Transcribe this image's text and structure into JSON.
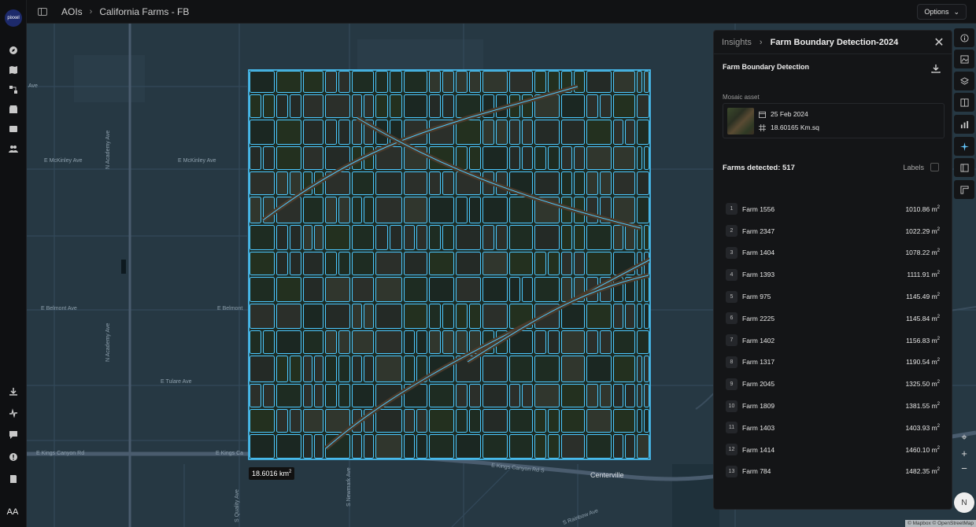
{
  "logo": {
    "text": "pixxel"
  },
  "avatar": {
    "initials": "AA"
  },
  "breadcrumb": {
    "root": "AOIs",
    "current": "California Farms - FB"
  },
  "header": {
    "options_label": "Options"
  },
  "map": {
    "roads": {
      "mckinley_left": "E McKinley Ave",
      "mckinley_right": "E McKinley Ave",
      "belmont_left": "E Belmont Ave",
      "belmont_right": "E Belmont",
      "tulare": "E Tulare Ave",
      "kings_left": "E Kings Canyon Rd",
      "kings_right": "E Kings Ca",
      "kings_s": "E Kings Canyon Rd S",
      "academy": "N Academy Ave",
      "academy_s": "N Academy Ave",
      "quality": "S Quality Ave",
      "newmark": "S Newmark Ave",
      "rainbow": "S Rainbow Ave",
      "ave_top": "Ave"
    },
    "city": "Centerville",
    "scale_text": "18.6016 km",
    "scale_sup": "2",
    "attribution": "© Mapbox © OpenStreetMap"
  },
  "panel": {
    "breadcrumb_root": "Insights",
    "breadcrumb_current": "Farm Boundary Detection-2024",
    "section_title": "Farm Boundary Detection",
    "mosaic_label": "Mosaic asset",
    "mosaic_date": "25 Feb 2024",
    "mosaic_area": "18.60165 Km.sq",
    "farms_detected": "Farms detected: 517",
    "labels_toggle": "Labels",
    "area_unit": "m",
    "area_sup": "2",
    "farms": [
      {
        "idx": "1",
        "name": "Farm 1556",
        "area": "1010.86"
      },
      {
        "idx": "2",
        "name": "Farm 2347",
        "area": "1022.29"
      },
      {
        "idx": "3",
        "name": "Farm 1404",
        "area": "1078.22"
      },
      {
        "idx": "4",
        "name": "Farm 1393",
        "area": "1111.91"
      },
      {
        "idx": "5",
        "name": "Farm 975",
        "area": "1145.49"
      },
      {
        "idx": "6",
        "name": "Farm 2225",
        "area": "1145.84"
      },
      {
        "idx": "7",
        "name": "Farm 1402",
        "area": "1156.83"
      },
      {
        "idx": "8",
        "name": "Farm 1317",
        "area": "1190.54"
      },
      {
        "idx": "9",
        "name": "Farm 2045",
        "area": "1325.50"
      },
      {
        "idx": "10",
        "name": "Farm 1809",
        "area": "1381.55"
      },
      {
        "idx": "11",
        "name": "Farm 1403",
        "area": "1403.93"
      },
      {
        "idx": "12",
        "name": "Farm 1414",
        "area": "1460.10"
      },
      {
        "idx": "13",
        "name": "Farm 784",
        "area": "1482.35"
      }
    ]
  },
  "right_rail": {
    "compass": "N"
  },
  "colors": {
    "boundary": "#4cc8ff",
    "map_bg": "#263843",
    "accent": "#64c8ff"
  }
}
